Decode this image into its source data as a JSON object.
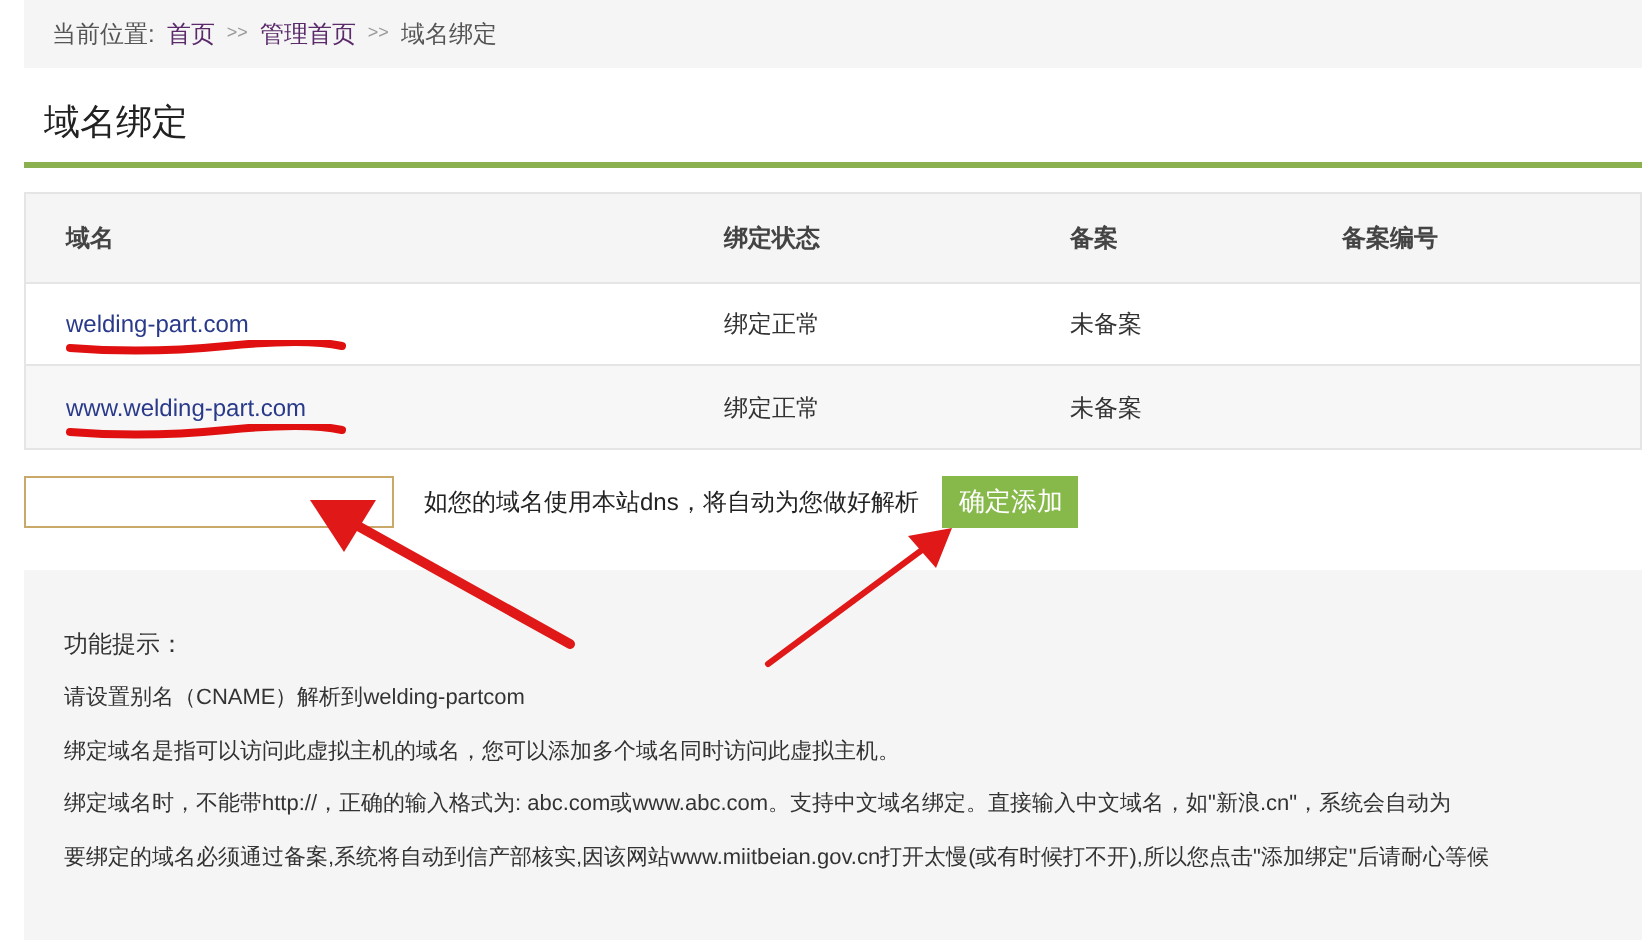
{
  "breadcrumb": {
    "label": "当前位置:",
    "links": [
      "首页",
      "管理首页"
    ],
    "separator": ">>",
    "current": "域名绑定"
  },
  "title": "域名绑定",
  "table": {
    "columns": [
      "域名",
      "绑定状态",
      "备案",
      "备案编号"
    ],
    "rows": [
      {
        "domain": "welding-part.com",
        "status": "绑定正常",
        "filing": "未备案"
      },
      {
        "domain": "www.welding-part.com",
        "status": "绑定正常",
        "filing": "未备案"
      }
    ]
  },
  "add_form": {
    "hint": "如您的域名使用本站dns，将自动为您做好解析",
    "button": "确定添加"
  },
  "tips": {
    "title": "功能提示：",
    "lines": [
      "请设置别名（CNAME）解析到welding-partcom",
      "绑定域名是指可以访问此虚拟主机的域名，您可以添加多个域名同时访问此虚拟主机。",
      "绑定域名时，不能带http://，正确的输入格式为: abc.com或www.abc.com。支持中文域名绑定。直接输入中文域名，如\"新浪.cn\"，系统会自动为",
      "要绑定的域名必须通过备案,系统将自动到信产部核实,因该网站www.miitbeian.gov.cn打开太慢(或有时候打不开),所以您点击\"添加绑定\"后请耐心等候"
    ]
  }
}
